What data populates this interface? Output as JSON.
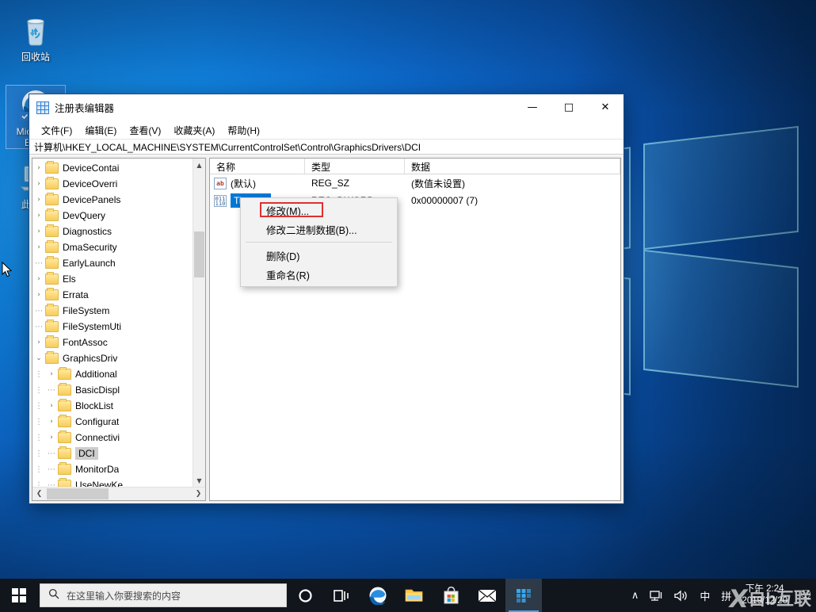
{
  "desktop": {
    "icons": [
      {
        "name": "recycle-bin",
        "label": "回收站"
      },
      {
        "name": "microsoft-edge",
        "label": "Microsoft Edge"
      },
      {
        "name": "this-pc",
        "label": "此电脑"
      }
    ]
  },
  "regedit": {
    "title": "注册表编辑器",
    "icon": "registry-icon",
    "window_buttons": {
      "minimize": "—",
      "maximize": "□",
      "close": "✕"
    },
    "menus": [
      {
        "name": "file",
        "label": "文件(F)"
      },
      {
        "name": "edit",
        "label": "编辑(E)"
      },
      {
        "name": "view",
        "label": "查看(V)"
      },
      {
        "name": "favorites",
        "label": "收藏夹(A)"
      },
      {
        "name": "help",
        "label": "帮助(H)"
      }
    ],
    "address": "计算机\\HKEY_LOCAL_MACHINE\\SYSTEM\\CurrentControlSet\\Control\\GraphicsDrivers\\DCI",
    "tree": [
      {
        "label": "DeviceContai",
        "indent": 1,
        "expander": "›",
        "selected": false
      },
      {
        "label": "DeviceOverri",
        "indent": 1,
        "expander": "›",
        "selected": false
      },
      {
        "label": "DevicePanels",
        "indent": 1,
        "expander": "›",
        "selected": false
      },
      {
        "label": "DevQuery",
        "indent": 1,
        "expander": "›",
        "selected": false
      },
      {
        "label": "Diagnostics",
        "indent": 1,
        "expander": "›",
        "selected": false
      },
      {
        "label": "DmaSecurity",
        "indent": 1,
        "expander": "›",
        "selected": false
      },
      {
        "label": "EarlyLaunch",
        "indent": 1,
        "expander": "",
        "selected": false
      },
      {
        "label": "Els",
        "indent": 1,
        "expander": "›",
        "selected": false
      },
      {
        "label": "Errata",
        "indent": 1,
        "expander": "›",
        "selected": false
      },
      {
        "label": "FileSystem",
        "indent": 1,
        "expander": "",
        "selected": false
      },
      {
        "label": "FileSystemUti",
        "indent": 1,
        "expander": "",
        "selected": false
      },
      {
        "label": "FontAssoc",
        "indent": 1,
        "expander": "›",
        "selected": false
      },
      {
        "label": "GraphicsDriv",
        "indent": 1,
        "expander": "⌄",
        "selected": false
      },
      {
        "label": "Additional",
        "indent": 2,
        "expander": "›",
        "selected": false
      },
      {
        "label": "BasicDispl",
        "indent": 2,
        "expander": "",
        "selected": false
      },
      {
        "label": "BlockList",
        "indent": 2,
        "expander": "›",
        "selected": false
      },
      {
        "label": "Configurat",
        "indent": 2,
        "expander": "›",
        "selected": false
      },
      {
        "label": "Connectivi",
        "indent": 2,
        "expander": "›",
        "selected": false
      },
      {
        "label": "DCI",
        "indent": 2,
        "expander": "",
        "selected": true
      },
      {
        "label": "MonitorDa",
        "indent": 2,
        "expander": "",
        "selected": false
      },
      {
        "label": "UseNewKe",
        "indent": 2,
        "expander": "",
        "selected": false
      }
    ],
    "columns": [
      {
        "name": "name",
        "label": "名称"
      },
      {
        "name": "type",
        "label": "类型"
      },
      {
        "name": "data",
        "label": "数据"
      }
    ],
    "values": [
      {
        "icon": "string-value-icon",
        "name": "(默认)",
        "type": "REG_SZ",
        "data": "(数值未设置)",
        "selected": false
      },
      {
        "icon": "dword-value-icon",
        "name": "Timeout",
        "type": "REG_DWORD",
        "data": "0x00000007 (7)",
        "selected": true
      }
    ]
  },
  "context_menu": {
    "items": [
      {
        "name": "modify",
        "label": "修改(M)...",
        "highlighted": true,
        "separator_after": false
      },
      {
        "name": "modify-binary",
        "label": "修改二进制数据(B)...",
        "highlighted": false,
        "separator_after": true
      },
      {
        "name": "delete",
        "label": "删除(D)",
        "highlighted": false,
        "separator_after": false
      },
      {
        "name": "rename",
        "label": "重命名(R)",
        "highlighted": false,
        "separator_after": false
      }
    ],
    "highlight_color": "#e03030"
  },
  "taskbar": {
    "start_label": "开始",
    "search_placeholder": "在这里输入你要搜索的内容",
    "search_value": "",
    "buttons": [
      {
        "name": "cortana",
        "glyph": "◯",
        "active": false
      },
      {
        "name": "task-view",
        "glyph": "❑",
        "active": false
      },
      {
        "name": "edge",
        "glyph": "e",
        "active": false
      },
      {
        "name": "file-explorer",
        "glyph": "🗀",
        "active": false
      },
      {
        "name": "microsoft-store",
        "glyph": "🛍",
        "active": false
      },
      {
        "name": "mail",
        "glyph": "✉",
        "active": false
      },
      {
        "name": "registry-editor",
        "glyph": "▦",
        "active": true
      }
    ],
    "tray": [
      {
        "name": "show-hidden-icons",
        "glyph": "∧"
      },
      {
        "name": "network",
        "glyph": "🖧"
      },
      {
        "name": "volume",
        "glyph": "🔊"
      },
      {
        "name": "ime-language",
        "glyph": "中"
      },
      {
        "name": "ime-pinyin",
        "glyph": "拼"
      }
    ],
    "clock": {
      "time": "下午 2:24",
      "date": "2019/12/20"
    },
    "notifications": "🗨"
  },
  "watermark": {
    "mark": "X",
    "text": "自b互联"
  }
}
